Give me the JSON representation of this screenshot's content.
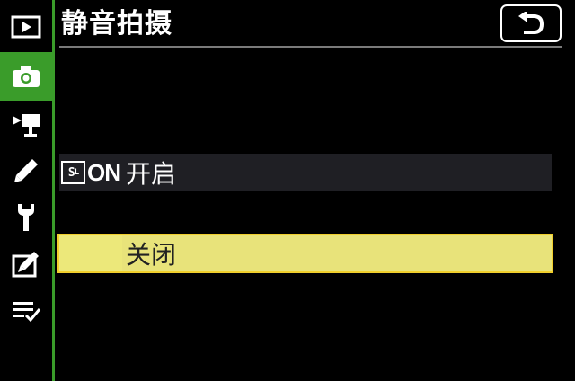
{
  "header": {
    "title": "静音拍摄",
    "back_icon": "return-arrow-icon"
  },
  "rail": {
    "items": [
      {
        "name": "playback-menu",
        "icon": "playback-icon",
        "active": false
      },
      {
        "name": "photo-shooting-menu",
        "icon": "camera-icon",
        "active": true
      },
      {
        "name": "movie-shooting-menu",
        "icon": "movie-camera-icon",
        "active": false
      },
      {
        "name": "custom-settings-menu",
        "icon": "pencil-icon",
        "active": false
      },
      {
        "name": "setup-menu",
        "icon": "wrench-icon",
        "active": false
      },
      {
        "name": "retouch-menu",
        "icon": "retouch-icon",
        "active": false
      },
      {
        "name": "my-menu",
        "icon": "my-menu-icon",
        "active": false
      }
    ]
  },
  "options": [
    {
      "badge": "S",
      "badge_on": "ON",
      "label": "开启",
      "selected": false
    },
    {
      "label": "关闭",
      "selected": true
    }
  ],
  "colors": {
    "accent_green": "#3a9c2a",
    "highlight_yellow": "#ece87a",
    "highlight_border": "#f1cf2c"
  }
}
